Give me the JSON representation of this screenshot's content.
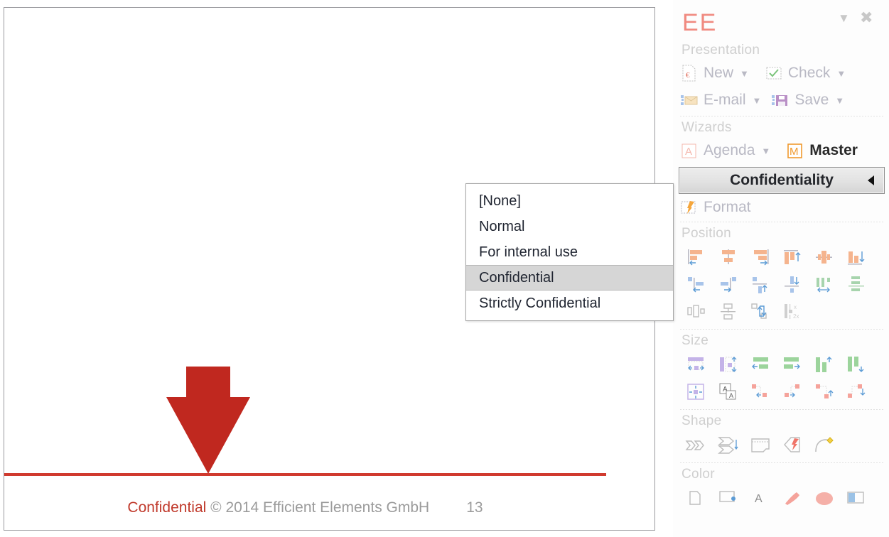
{
  "slide": {
    "footer": {
      "confidential_label": "Confidential",
      "copyright": " © 2014 Efficient Elements GmbH",
      "page_number": "13"
    },
    "arrow_color": "#c0281f",
    "rule_color": "#d03a2e",
    "confidential_color": "#c0392b"
  },
  "menu": {
    "name": "confidentiality-menu",
    "items": [
      {
        "label": "[None]",
        "selected": false
      },
      {
        "label": "Normal",
        "selected": false
      },
      {
        "label": "For internal use",
        "selected": false
      },
      {
        "label": "Confidential",
        "selected": true
      },
      {
        "label": "Strictly Confidential",
        "selected": false
      }
    ]
  },
  "panel": {
    "logo": "EE",
    "collapse_icon": "chevron-down-icon",
    "close_icon": "close-icon",
    "groups": {
      "presentation": {
        "label": "Presentation",
        "commands": [
          {
            "label": "New",
            "icon": "new-presentation-icon",
            "has_caret": true,
            "strong": false
          },
          {
            "label": "Check",
            "icon": "check-icon",
            "has_caret": true,
            "strong": false
          },
          {
            "label": "E-mail",
            "icon": "email-icon",
            "has_caret": true,
            "strong": false
          },
          {
            "label": "Save",
            "icon": "save-icon",
            "has_caret": true,
            "strong": false
          }
        ]
      },
      "wizards": {
        "label": "Wizards",
        "commands": [
          {
            "label": "Agenda",
            "icon": "agenda-icon",
            "has_caret": true,
            "strong": false
          },
          {
            "label": "Master",
            "icon": "master-icon",
            "has_caret": false,
            "strong": true
          }
        ]
      },
      "confidentiality": {
        "label": "Confidentiality",
        "expander_icon": "triangle-left-icon",
        "commands": [
          {
            "label": "Format",
            "icon": "format-icon",
            "has_caret": false,
            "strong": false
          }
        ]
      },
      "position": {
        "label": "Position",
        "icons": [
          "align-left-icon",
          "align-center-icon",
          "align-right-icon",
          "align-top-icon",
          "align-middle-icon",
          "align-bottom-icon",
          "snap-left-icon",
          "snap-right-icon",
          "snap-top-icon",
          "snap-bottom-icon",
          "distribute-horizontal-icon",
          "distribute-vertical-icon",
          "spread-horizontal-icon",
          "stack-vertical-icon",
          "swap-positions-icon",
          "matrix-layout-icon"
        ]
      },
      "size": {
        "label": "Size",
        "icons": [
          "width-same-icon",
          "height-same-icon",
          "width-min-icon",
          "width-max-icon",
          "height-min-icon",
          "height-max-icon",
          "fit-both-icon",
          "autofit-text-icon",
          "nudge-left-icon",
          "nudge-right-icon",
          "nudge-up-icon",
          "nudge-down-icon"
        ]
      },
      "shape": {
        "label": "Shape",
        "icons": [
          "chevron-shapes-icon",
          "arrow-stack-icon",
          "banner-shape-icon",
          "shape-convert-icon",
          "curve-connector-icon"
        ]
      },
      "color": {
        "label": "Color",
        "icons": [
          "color-picker-icon",
          "fill-color-icon",
          "font-color-icon",
          "brush-color-icon",
          "palette-icon",
          "theme-color-icon"
        ]
      }
    }
  }
}
